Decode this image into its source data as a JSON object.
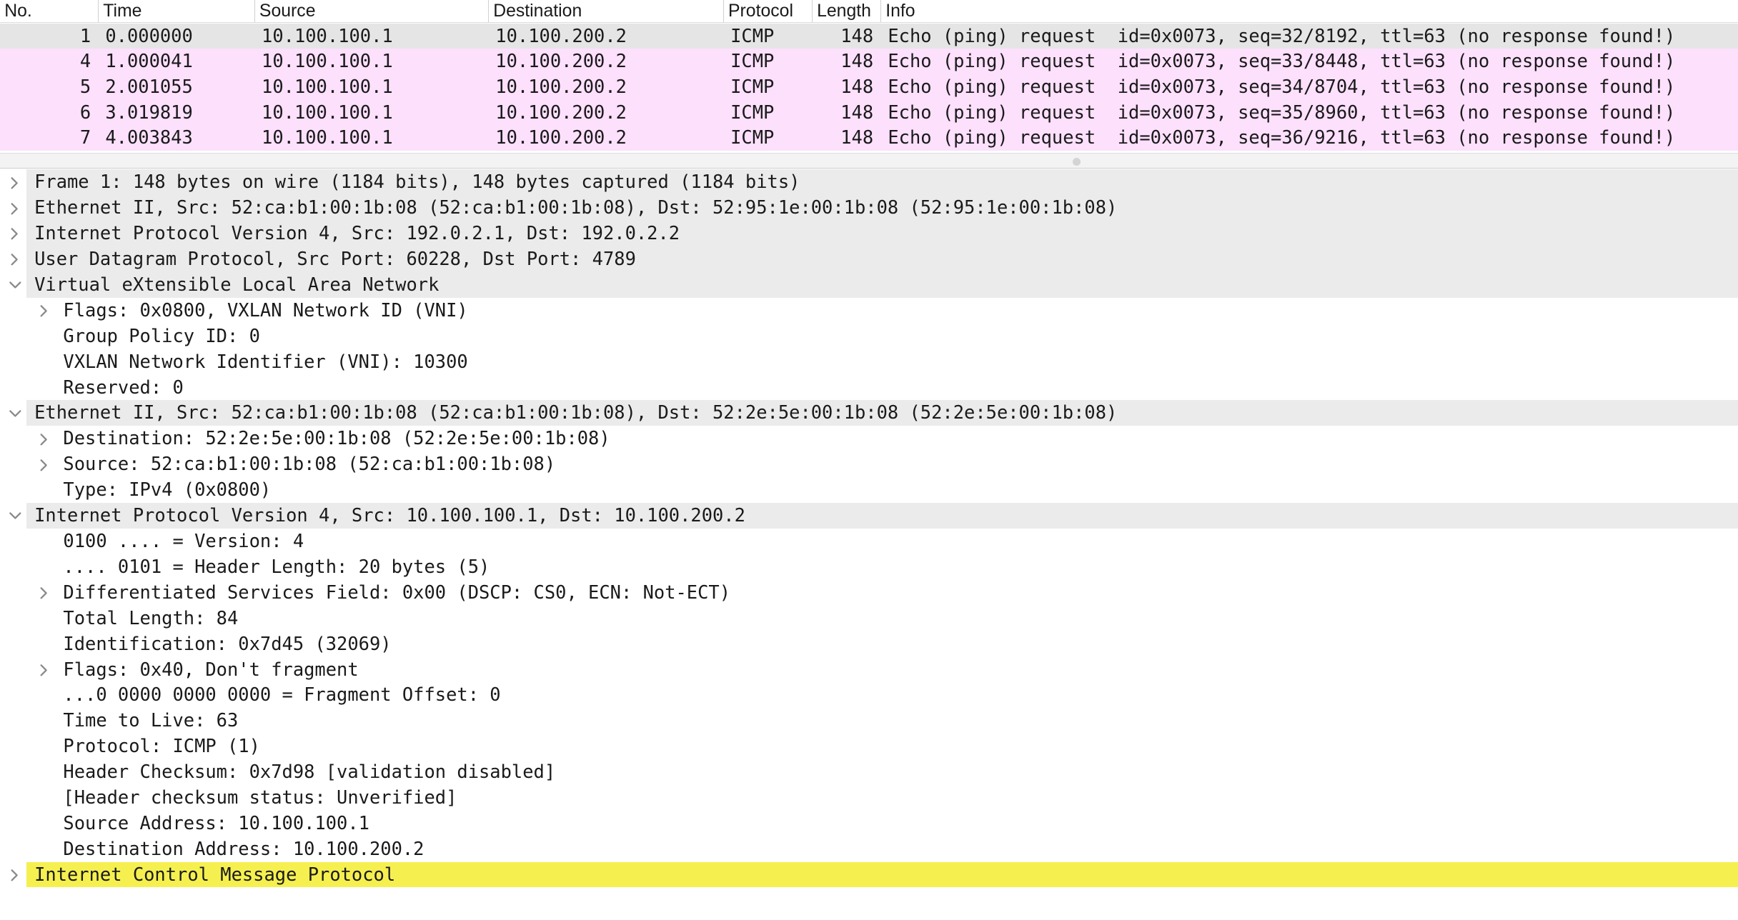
{
  "packet_list": {
    "columns": [
      "No.",
      "Time",
      "Source",
      "Destination",
      "Protocol",
      "Length",
      "Info"
    ],
    "rows": [
      {
        "no": "1",
        "time": "0.000000",
        "source": "10.100.100.1",
        "destination": "10.100.200.2",
        "protocol": "ICMP",
        "length": "148",
        "info": "Echo (ping) request  id=0x0073, seq=32/8192, ttl=63 (no response found!)"
      },
      {
        "no": "4",
        "time": "1.000041",
        "source": "10.100.100.1",
        "destination": "10.100.200.2",
        "protocol": "ICMP",
        "length": "148",
        "info": "Echo (ping) request  id=0x0073, seq=33/8448, ttl=63 (no response found!)"
      },
      {
        "no": "5",
        "time": "2.001055",
        "source": "10.100.100.1",
        "destination": "10.100.200.2",
        "protocol": "ICMP",
        "length": "148",
        "info": "Echo (ping) request  id=0x0073, seq=34/8704, ttl=63 (no response found!)"
      },
      {
        "no": "6",
        "time": "3.019819",
        "source": "10.100.100.1",
        "destination": "10.100.200.2",
        "protocol": "ICMP",
        "length": "148",
        "info": "Echo (ping) request  id=0x0073, seq=35/8960, ttl=63 (no response found!)"
      },
      {
        "no": "7",
        "time": "4.003843",
        "source": "10.100.100.1",
        "destination": "10.100.200.2",
        "protocol": "ICMP",
        "length": "148",
        "info": "Echo (ping) request  id=0x0073, seq=36/9216, ttl=63 (no response found!)"
      }
    ]
  },
  "details": {
    "lines": [
      {
        "text": "Frame 1: 148 bytes on wire (1184 bits), 148 bytes captured (1184 bits)",
        "level": 0,
        "arrow": "collapsed"
      },
      {
        "text": "Ethernet II, Src: 52:ca:b1:00:1b:08 (52:ca:b1:00:1b:08), Dst: 52:95:1e:00:1b:08 (52:95:1e:00:1b:08)",
        "level": 0,
        "arrow": "collapsed"
      },
      {
        "text": "Internet Protocol Version 4, Src: 192.0.2.1, Dst: 192.0.2.2",
        "level": 0,
        "arrow": "collapsed"
      },
      {
        "text": "User Datagram Protocol, Src Port: 60228, Dst Port: 4789",
        "level": 0,
        "arrow": "collapsed"
      },
      {
        "text": "Virtual eXtensible Local Area Network",
        "level": 0,
        "arrow": "expanded"
      },
      {
        "text": "Flags: 0x0800, VXLAN Network ID (VNI)",
        "level": 1,
        "arrow": "collapsed"
      },
      {
        "text": "Group Policy ID: 0",
        "level": 1,
        "arrow": "none"
      },
      {
        "text": "VXLAN Network Identifier (VNI): 10300",
        "level": 1,
        "arrow": "none"
      },
      {
        "text": "Reserved: 0",
        "level": 1,
        "arrow": "none"
      },
      {
        "text": "Ethernet II, Src: 52:ca:b1:00:1b:08 (52:ca:b1:00:1b:08), Dst: 52:2e:5e:00:1b:08 (52:2e:5e:00:1b:08)",
        "level": 0,
        "arrow": "expanded"
      },
      {
        "text": "Destination: 52:2e:5e:00:1b:08 (52:2e:5e:00:1b:08)",
        "level": 1,
        "arrow": "collapsed"
      },
      {
        "text": "Source: 52:ca:b1:00:1b:08 (52:ca:b1:00:1b:08)",
        "level": 1,
        "arrow": "collapsed"
      },
      {
        "text": "Type: IPv4 (0x0800)",
        "level": 1,
        "arrow": "none"
      },
      {
        "text": "Internet Protocol Version 4, Src: 10.100.100.1, Dst: 10.100.200.2",
        "level": 0,
        "arrow": "expanded"
      },
      {
        "text": "0100 .... = Version: 4",
        "level": 1,
        "arrow": "none"
      },
      {
        "text": ".... 0101 = Header Length: 20 bytes (5)",
        "level": 1,
        "arrow": "none"
      },
      {
        "text": "Differentiated Services Field: 0x00 (DSCP: CS0, ECN: Not-ECT)",
        "level": 1,
        "arrow": "collapsed"
      },
      {
        "text": "Total Length: 84",
        "level": 1,
        "arrow": "none"
      },
      {
        "text": "Identification: 0x7d45 (32069)",
        "level": 1,
        "arrow": "none"
      },
      {
        "text": "Flags: 0x40, Don't fragment",
        "level": 1,
        "arrow": "collapsed"
      },
      {
        "text": "...0 0000 0000 0000 = Fragment Offset: 0",
        "level": 1,
        "arrow": "none"
      },
      {
        "text": "Time to Live: 63",
        "level": 1,
        "arrow": "none"
      },
      {
        "text": "Protocol: ICMP (1)",
        "level": 1,
        "arrow": "none"
      },
      {
        "text": "Header Checksum: 0x7d98 [validation disabled]",
        "level": 1,
        "arrow": "none"
      },
      {
        "text": "[Header checksum status: Unverified]",
        "level": 1,
        "arrow": "none"
      },
      {
        "text": "Source Address: 10.100.100.1",
        "level": 1,
        "arrow": "none"
      },
      {
        "text": "Destination Address: 10.100.200.2",
        "level": 1,
        "arrow": "none"
      },
      {
        "text": "Internet Control Message Protocol",
        "level": 0,
        "arrow": "collapsed",
        "state": "highlighted"
      }
    ]
  },
  "colors": {
    "icmp_row": "#fce0fc",
    "selected_row": "#e5e5e5",
    "highlight": "#f5f04f"
  }
}
